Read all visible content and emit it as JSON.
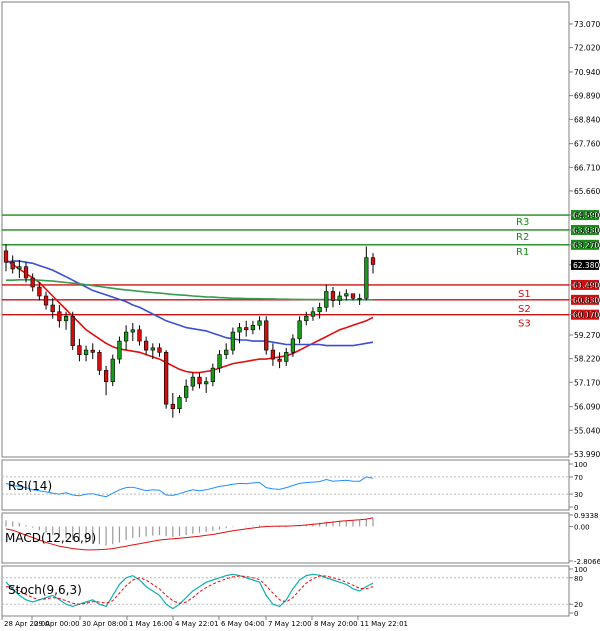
{
  "chart_data": [
    {
      "type": "candlestick",
      "panel": "price",
      "y_ticks": [
        "73.070",
        "72.020",
        "70.940",
        "69.890",
        "68.840",
        "67.760",
        "66.710",
        "65.660",
        "64.590",
        "63.930",
        "63.270",
        "62.380",
        "61.490",
        "60.830",
        "60.170",
        "59.270",
        "58.220",
        "57.170",
        "56.090",
        "55.040",
        "53.990"
      ],
      "ylim": [
        53.99,
        73.6
      ],
      "last_price": "62.380",
      "levels": [
        {
          "name": "R3",
          "value": 64.59,
          "label": "64.590",
          "color": "#1a8a1a"
        },
        {
          "name": "R2",
          "value": 63.93,
          "label": "63.930",
          "color": "#1a8a1a"
        },
        {
          "name": "R1",
          "value": 63.27,
          "label": "63.270",
          "color": "#1a8a1a"
        },
        {
          "name": "S1",
          "value": 61.49,
          "label": "61.490",
          "color": "#d01010"
        },
        {
          "name": "S2",
          "value": 60.83,
          "label": "60.830",
          "color": "#d01010"
        },
        {
          "name": "S3",
          "value": 60.17,
          "label": "60.170",
          "color": "#d01010"
        }
      ],
      "candles": [
        {
          "o": 63.0,
          "h": 63.3,
          "l": 62.1,
          "c": 62.5
        },
        {
          "o": 62.5,
          "h": 62.8,
          "l": 62.0,
          "c": 62.2
        },
        {
          "o": 62.2,
          "h": 62.6,
          "l": 61.8,
          "c": 62.3
        },
        {
          "o": 62.3,
          "h": 62.5,
          "l": 61.6,
          "c": 61.8
        },
        {
          "o": 61.8,
          "h": 62.0,
          "l": 61.2,
          "c": 61.4
        },
        {
          "o": 61.4,
          "h": 61.6,
          "l": 60.8,
          "c": 61.0
        },
        {
          "o": 61.0,
          "h": 61.2,
          "l": 60.4,
          "c": 60.6
        },
        {
          "o": 60.6,
          "h": 60.9,
          "l": 60.0,
          "c": 60.3
        },
        {
          "o": 60.3,
          "h": 60.6,
          "l": 59.6,
          "c": 59.9
        },
        {
          "o": 59.9,
          "h": 60.3,
          "l": 59.5,
          "c": 60.1
        },
        {
          "o": 60.1,
          "h": 60.3,
          "l": 58.6,
          "c": 58.8
        },
        {
          "o": 58.8,
          "h": 59.1,
          "l": 58.1,
          "c": 58.4
        },
        {
          "o": 58.4,
          "h": 58.8,
          "l": 58.1,
          "c": 58.6
        },
        {
          "o": 58.6,
          "h": 58.9,
          "l": 58.2,
          "c": 58.5
        },
        {
          "o": 58.5,
          "h": 58.6,
          "l": 57.5,
          "c": 57.7
        },
        {
          "o": 57.7,
          "h": 57.9,
          "l": 56.6,
          "c": 57.2
        },
        {
          "o": 57.2,
          "h": 58.4,
          "l": 57.0,
          "c": 58.2
        },
        {
          "o": 58.2,
          "h": 59.2,
          "l": 58.0,
          "c": 59.0
        },
        {
          "o": 59.0,
          "h": 59.7,
          "l": 58.6,
          "c": 59.4
        },
        {
          "o": 59.4,
          "h": 59.8,
          "l": 59.0,
          "c": 59.5
        },
        {
          "o": 59.5,
          "h": 59.7,
          "l": 58.8,
          "c": 59.0
        },
        {
          "o": 59.0,
          "h": 59.2,
          "l": 58.4,
          "c": 58.6
        },
        {
          "o": 58.6,
          "h": 58.9,
          "l": 58.2,
          "c": 58.7
        },
        {
          "o": 58.7,
          "h": 58.9,
          "l": 58.3,
          "c": 58.5
        },
        {
          "o": 58.5,
          "h": 58.6,
          "l": 56.0,
          "c": 56.2
        },
        {
          "o": 56.2,
          "h": 56.7,
          "l": 55.6,
          "c": 56.0
        },
        {
          "o": 56.0,
          "h": 56.6,
          "l": 55.8,
          "c": 56.5
        },
        {
          "o": 56.5,
          "h": 57.3,
          "l": 56.3,
          "c": 57.0
        },
        {
          "o": 57.0,
          "h": 57.6,
          "l": 56.8,
          "c": 57.4
        },
        {
          "o": 57.4,
          "h": 57.6,
          "l": 56.9,
          "c": 57.1
        },
        {
          "o": 57.1,
          "h": 57.4,
          "l": 56.7,
          "c": 57.2
        },
        {
          "o": 57.2,
          "h": 58.0,
          "l": 57.0,
          "c": 57.8
        },
        {
          "o": 57.8,
          "h": 58.6,
          "l": 57.6,
          "c": 58.4
        },
        {
          "o": 58.4,
          "h": 58.9,
          "l": 58.2,
          "c": 58.6
        },
        {
          "o": 58.6,
          "h": 59.6,
          "l": 58.4,
          "c": 59.4
        },
        {
          "o": 59.4,
          "h": 59.8,
          "l": 58.9,
          "c": 59.6
        },
        {
          "o": 59.6,
          "h": 59.9,
          "l": 59.2,
          "c": 59.5
        },
        {
          "o": 59.5,
          "h": 59.9,
          "l": 59.3,
          "c": 59.7
        },
        {
          "o": 59.7,
          "h": 60.1,
          "l": 59.5,
          "c": 59.9
        },
        {
          "o": 59.9,
          "h": 60.1,
          "l": 58.4,
          "c": 58.6
        },
        {
          "o": 58.6,
          "h": 58.9,
          "l": 57.9,
          "c": 58.2
        },
        {
          "o": 58.2,
          "h": 58.5,
          "l": 57.8,
          "c": 58.1
        },
        {
          "o": 58.1,
          "h": 58.7,
          "l": 57.9,
          "c": 58.5
        },
        {
          "o": 58.5,
          "h": 59.3,
          "l": 58.3,
          "c": 59.1
        },
        {
          "o": 59.1,
          "h": 60.1,
          "l": 58.9,
          "c": 59.9
        },
        {
          "o": 59.9,
          "h": 60.3,
          "l": 59.7,
          "c": 60.1
        },
        {
          "o": 60.1,
          "h": 60.5,
          "l": 59.9,
          "c": 60.3
        },
        {
          "o": 60.3,
          "h": 60.7,
          "l": 60.0,
          "c": 60.5
        },
        {
          "o": 60.5,
          "h": 61.5,
          "l": 60.3,
          "c": 61.2
        },
        {
          "o": 61.2,
          "h": 61.4,
          "l": 60.5,
          "c": 60.8
        },
        {
          "o": 60.8,
          "h": 61.2,
          "l": 60.6,
          "c": 61.0
        },
        {
          "o": 61.0,
          "h": 61.3,
          "l": 60.8,
          "c": 61.1
        },
        {
          "o": 61.1,
          "h": 61.1,
          "l": 60.8,
          "c": 60.9
        },
        {
          "o": 60.9,
          "h": 61.1,
          "l": 60.6,
          "c": 60.9
        },
        {
          "o": 60.9,
          "h": 63.2,
          "l": 60.8,
          "c": 62.7
        },
        {
          "o": 62.7,
          "h": 62.9,
          "l": 62.0,
          "c": 62.4
        }
      ],
      "moving_averages": [
        {
          "color": "#e01010",
          "values": [
            62.6,
            62.4,
            62.2,
            62.0,
            61.8,
            61.6,
            61.3,
            61.0,
            60.7,
            60.4,
            60.1,
            59.8,
            59.5,
            59.3,
            59.1,
            58.9,
            58.75,
            58.65,
            58.6,
            58.55,
            58.5,
            58.4,
            58.3,
            58.2,
            58.05,
            57.9,
            57.75,
            57.65,
            57.6,
            57.6,
            57.65,
            57.7,
            57.8,
            57.9,
            58.0,
            58.05,
            58.1,
            58.15,
            58.2,
            58.2,
            58.25,
            58.3,
            58.35,
            58.45,
            58.6,
            58.75,
            58.9,
            59.05,
            59.2,
            59.35,
            59.5,
            59.6,
            59.7,
            59.8,
            59.9,
            60.05
          ]
        },
        {
          "color": "#3a50d0",
          "values": [
            62.5,
            62.55,
            62.55,
            62.5,
            62.45,
            62.35,
            62.25,
            62.15,
            62.0,
            61.85,
            61.7,
            61.55,
            61.4,
            61.25,
            61.15,
            61.05,
            60.95,
            60.85,
            60.75,
            60.6,
            60.5,
            60.35,
            60.2,
            60.05,
            59.9,
            59.8,
            59.7,
            59.6,
            59.55,
            59.5,
            59.45,
            59.35,
            59.25,
            59.15,
            59.1,
            59.05,
            59.05,
            59.0,
            59.0,
            59.0,
            58.95,
            58.9,
            58.85,
            58.85,
            58.85,
            58.85,
            58.85,
            58.85,
            58.8,
            58.8,
            58.8,
            58.8,
            58.8,
            58.85,
            58.9,
            58.95
          ]
        },
        {
          "color": "#3a9a50",
          "values": [
            61.7,
            61.7,
            61.72,
            61.72,
            61.72,
            61.7,
            61.68,
            61.66,
            61.63,
            61.6,
            61.57,
            61.54,
            61.5,
            61.46,
            61.42,
            61.38,
            61.34,
            61.3,
            61.27,
            61.24,
            61.21,
            61.18,
            61.15,
            61.13,
            61.1,
            61.07,
            61.05,
            61.03,
            61.0,
            60.98,
            60.96,
            60.95,
            60.93,
            60.92,
            60.9,
            60.9,
            60.89,
            60.88,
            60.88,
            60.87,
            60.87,
            60.86,
            60.86,
            60.85,
            60.85,
            60.84,
            60.84,
            60.84,
            60.84,
            60.83,
            60.83,
            60.83,
            60.83,
            60.83,
            60.83,
            60.83
          ]
        }
      ]
    },
    {
      "type": "line",
      "panel": "rsi",
      "label": "RSI(14)",
      "y_ticks": [
        "100",
        "70",
        "30",
        "0"
      ],
      "ylim": [
        0,
        100
      ],
      "values": [
        55,
        50,
        48,
        45,
        40,
        38,
        35,
        32,
        30,
        33,
        28,
        26,
        30,
        31,
        27,
        24,
        32,
        40,
        45,
        46,
        42,
        38,
        40,
        39,
        28,
        27,
        31,
        36,
        40,
        38,
        40,
        44,
        48,
        50,
        53,
        55,
        54,
        56,
        57,
        45,
        42,
        41,
        45,
        50,
        55,
        57,
        58,
        59,
        64,
        60,
        61,
        62,
        60,
        60,
        70,
        67
      ]
    },
    {
      "type": "bar",
      "panel": "macd",
      "label": "MACD(12,26,9)",
      "y_ticks": [
        "0.9338",
        "0.00",
        "-2.8066"
      ],
      "ylim": [
        -2.8066,
        0.9338
      ],
      "values": [
        0.5,
        0.4,
        0.3,
        0.1,
        -0.1,
        -0.3,
        -0.5,
        -0.7,
        -0.85,
        -0.95,
        -1.1,
        -1.25,
        -1.35,
        -1.4,
        -1.45,
        -1.55,
        -1.45,
        -1.3,
        -1.1,
        -0.95,
        -0.85,
        -0.8,
        -0.75,
        -0.7,
        -0.8,
        -0.85,
        -0.8,
        -0.7,
        -0.6,
        -0.5,
        -0.45,
        -0.35,
        -0.25,
        -0.15,
        -0.05,
        0.0,
        0.05,
        0.05,
        0.1,
        0.05,
        0.0,
        -0.05,
        -0.05,
        0.0,
        0.1,
        0.18,
        0.25,
        0.32,
        0.4,
        0.42,
        0.45,
        0.48,
        0.5,
        0.52,
        0.62,
        0.68
      ],
      "signal": [
        -0.2,
        -0.3,
        -0.5,
        -0.7,
        -0.9,
        -1.1,
        -1.3,
        -1.45,
        -1.6,
        -1.7,
        -1.8,
        -1.85,
        -1.9,
        -1.9,
        -1.88,
        -1.85,
        -1.8,
        -1.7,
        -1.6,
        -1.5,
        -1.4,
        -1.3,
        -1.2,
        -1.1,
        -1.05,
        -1.0,
        -0.95,
        -0.9,
        -0.85,
        -0.8,
        -0.72,
        -0.65,
        -0.55,
        -0.45,
        -0.35,
        -0.28,
        -0.2,
        -0.12,
        -0.05,
        0.0,
        0.02,
        0.03,
        0.03,
        0.05,
        0.08,
        0.12,
        0.18,
        0.23,
        0.3,
        0.36,
        0.42,
        0.46,
        0.5,
        0.54,
        0.6,
        0.7
      ]
    },
    {
      "type": "line",
      "panel": "stochastic",
      "label": "Stoch(9,6,3)",
      "y_ticks": [
        "100",
        "80",
        "20",
        "0"
      ],
      "ylim": [
        0,
        100
      ],
      "main": [
        70,
        55,
        40,
        30,
        25,
        30,
        35,
        40,
        30,
        20,
        15,
        20,
        25,
        30,
        20,
        15,
        40,
        65,
        80,
        85,
        75,
        60,
        50,
        40,
        20,
        10,
        20,
        35,
        50,
        60,
        70,
        75,
        80,
        85,
        88,
        85,
        80,
        75,
        70,
        40,
        20,
        15,
        30,
        55,
        75,
        85,
        88,
        86,
        80,
        75,
        70,
        65,
        55,
        50,
        60,
        68
      ],
      "signal": [
        60,
        58,
        50,
        42,
        35,
        30,
        32,
        35,
        33,
        28,
        22,
        20,
        22,
        26,
        25,
        22,
        28,
        45,
        62,
        75,
        80,
        75,
        65,
        55,
        40,
        28,
        22,
        25,
        35,
        48,
        58,
        66,
        72,
        78,
        82,
        84,
        83,
        80,
        76,
        62,
        45,
        30,
        25,
        35,
        52,
        68,
        78,
        84,
        84,
        80,
        76,
        70,
        63,
        56,
        55,
        60
      ]
    }
  ],
  "x_ticks": [
    "28 Apr 20:00",
    "29 Apr 00:00",
    "30 Apr 08:00",
    "1 May 16:00",
    "4 May 22:01",
    "6 May 04:00",
    "7 May 12:00",
    "8 May 20:00",
    "11 May 22:01"
  ],
  "colors": {
    "up": "#1a9a1a",
    "down": "#d01010",
    "support": "#d01010",
    "resistance": "#1a8a1a"
  }
}
